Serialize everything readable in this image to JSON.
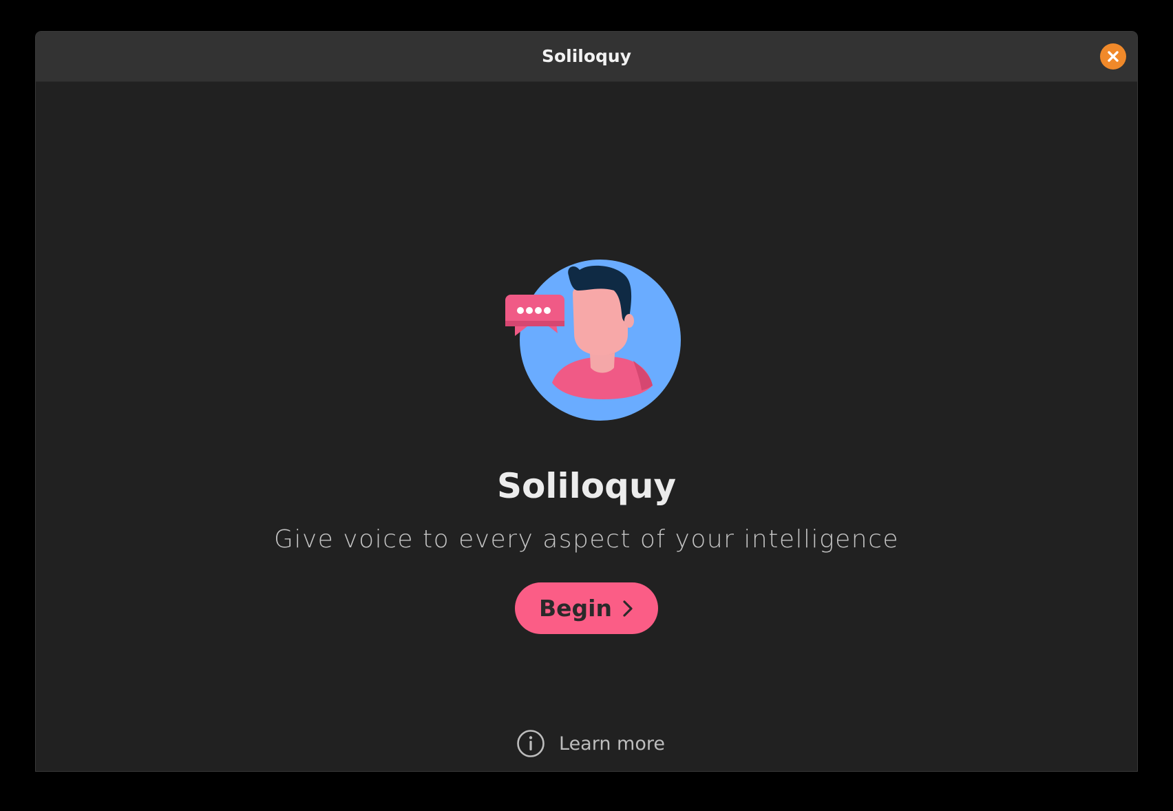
{
  "window": {
    "title": "Soliloquy"
  },
  "welcome": {
    "app_name": "Soliloquy",
    "tagline": "Give voice to every aspect of your intelligence",
    "begin_label": "Begin",
    "learn_more_label": "Learn more"
  },
  "icons": {
    "close": "close-icon",
    "app_logo": "app-logo-icon",
    "begin_arrow": "chevron-right-icon",
    "info": "info-icon"
  },
  "colors": {
    "close_button": "#f0892a",
    "begin_button": "#fb5d86",
    "logo_background": "#6aacff",
    "window_background": "#212121",
    "titlebar_background": "#333333"
  }
}
